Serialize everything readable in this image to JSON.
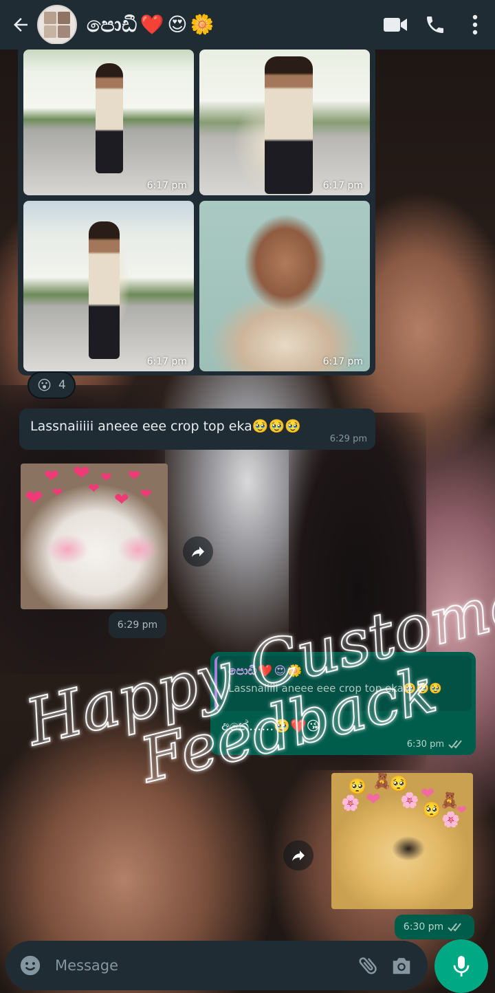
{
  "header": {
    "contact_name": "පොඩී",
    "name_emojis": [
      "❤️",
      "😍",
      "🌼"
    ],
    "icons": {
      "back": "arrow-left-icon",
      "video": "video-camera-icon",
      "call": "phone-icon",
      "menu": "more-vertical-icon"
    }
  },
  "media_album": {
    "photos": [
      {
        "time": "6:17 pm"
      },
      {
        "time": "6:17 pm"
      },
      {
        "time": "6:17 pm"
      },
      {
        "time": "6:17 pm"
      }
    ],
    "reaction": {
      "emoji": "😮",
      "count": "4"
    }
  },
  "messages": {
    "incoming_text": {
      "text": "Lassnaiiiii aneee eee crop top eka🥹🥹🥹",
      "time": "6:29 pm"
    },
    "incoming_sticker": {
      "time": "6:29 pm",
      "hearts": [
        "❤",
        "❤",
        "❤",
        "❤",
        "❤",
        "❤",
        "❤",
        "❤",
        "❤"
      ]
    },
    "outgoing_reply": {
      "quoted_author": "පොඩී",
      "quoted_author_emojis": [
        "❤️",
        "😍",
        "🌼"
      ],
      "quoted_text": "Lassnaiiiii aneee eee crop top eka🥹🥹🥹",
      "text": "අනේ......🥹❤️😘",
      "time": "6:30 pm",
      "status": "read"
    },
    "outgoing_sticker": {
      "time": "6:30 pm",
      "status": "read"
    }
  },
  "overlay": {
    "line1": "Happy Customer",
    "line2": "Feedback"
  },
  "input": {
    "placeholder": "Message",
    "icons": {
      "emoji": "smiley-icon",
      "attach": "paperclip-icon",
      "camera": "camera-icon",
      "mic": "microphone-icon"
    }
  },
  "colors": {
    "header_bg": "#1f2c34",
    "incoming_bubble": "#1f2c34",
    "outgoing_bubble": "#005c4b",
    "accent": "#00a884",
    "quote_bar": "#a57fdc"
  }
}
